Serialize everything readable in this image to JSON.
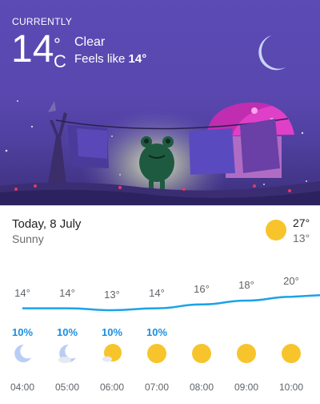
{
  "current": {
    "label": "CURRENTLY",
    "temperature": "14",
    "degree": "°",
    "unit": "C",
    "condition": "Clear",
    "feels_like_prefix": "Feels like",
    "feels_like_value": "14°"
  },
  "today": {
    "date": "Today, 8 July",
    "condition": "Sunny",
    "high": "27°",
    "low": "13°",
    "icon": "sun-icon"
  },
  "hourly": [
    {
      "time": "04:00",
      "temp": "14°",
      "precip": "10%",
      "icon": "moon-icon",
      "value": 14
    },
    {
      "time": "05:00",
      "temp": "14°",
      "precip": "10%",
      "icon": "moon-cloud-icon",
      "value": 14
    },
    {
      "time": "06:00",
      "temp": "13°",
      "precip": "10%",
      "icon": "sun-cloud-icon",
      "value": 13
    },
    {
      "time": "07:00",
      "temp": "14°",
      "precip": "10%",
      "icon": "sun-icon",
      "value": 14
    },
    {
      "time": "08:00",
      "temp": "16°",
      "precip": "",
      "icon": "sun-icon",
      "value": 16
    },
    {
      "time": "09:00",
      "temp": "18°",
      "precip": "",
      "icon": "sun-icon",
      "value": 18
    },
    {
      "time": "10:00",
      "temp": "20°",
      "precip": "",
      "icon": "sun-icon",
      "value": 20
    }
  ],
  "colors": {
    "sky": "#5c4ab5",
    "temp_line": "#1aa3e8",
    "precip": "#1a8fe3",
    "sun": "#f7c52b",
    "moon": "#b9cdf5"
  }
}
